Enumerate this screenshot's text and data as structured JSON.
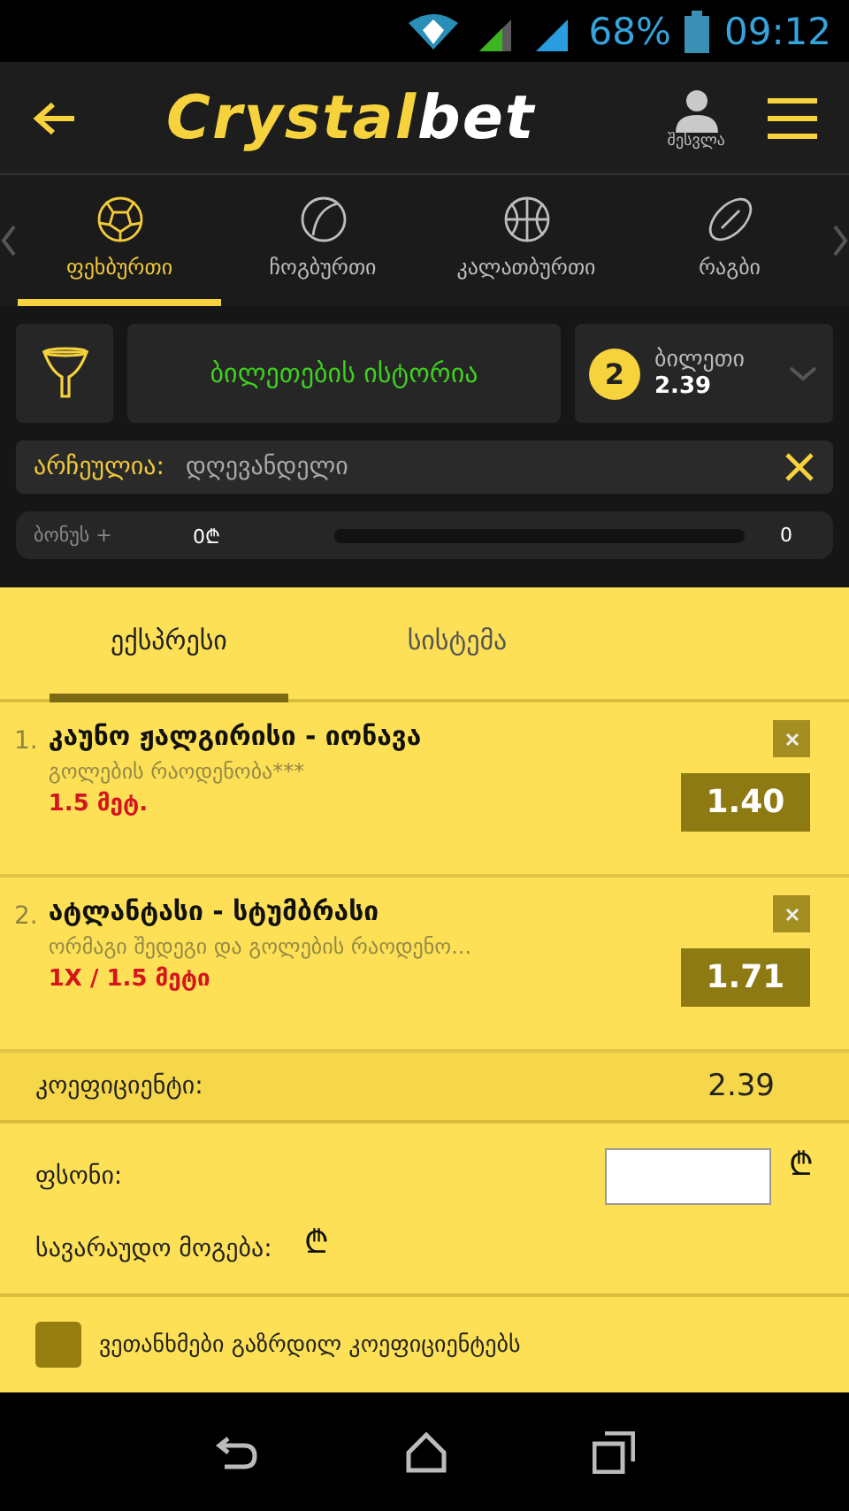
{
  "status_bar": {
    "battery": "68%",
    "time": "09:12"
  },
  "header": {
    "logo_part1": "Crystal",
    "logo_part2": "bet",
    "login": "შესვლა"
  },
  "sports": [
    {
      "label": "ფეხბურთი",
      "kind": "soccer",
      "selected": true
    },
    {
      "label": "ჩოგბურთი",
      "kind": "tennis",
      "selected": false
    },
    {
      "label": "კალათბურთი",
      "kind": "basketball",
      "selected": false
    },
    {
      "label": "რაგბი",
      "kind": "rugby",
      "selected": false
    }
  ],
  "history_button": "ბილეთების ისტორია",
  "ticket": {
    "count": "2",
    "label": "ბილეთი",
    "odds": "2.39"
  },
  "filter": {
    "label": "არჩეულია:",
    "value": "დღევანდელი"
  },
  "bonus": {
    "label": "ბონუს +",
    "amount": "0₾",
    "value": "0"
  },
  "bet_tabs": [
    {
      "label": "ექსპრესი",
      "selected": true
    },
    {
      "label": "სისტემა",
      "selected": false
    }
  ],
  "bets": [
    {
      "number": "1.",
      "match": "კაუნო ჟალგირისი - იონავა",
      "market": "გოლების რაოდენობა***",
      "pick": "1.5 მეტ.",
      "odds": "1.40"
    },
    {
      "number": "2.",
      "match": "ატლანტასი - სტუმბრასი",
      "market": "ორმაგი შედეგი და გოლების რაოდენო...",
      "pick": "1X / 1.5 მეტი",
      "odds": "1.71"
    }
  ],
  "coefficient": {
    "label": "კოეფიციენტი:",
    "value": "2.39"
  },
  "stake": {
    "label": "ფსონი:",
    "currency": "₾"
  },
  "possible_win": {
    "label": "სავარაუდო მოგება:",
    "currency": "₾"
  },
  "agree": {
    "label": "ვეთანხმები გაზრდილ კოეფიციენტებს",
    "checked": false
  }
}
